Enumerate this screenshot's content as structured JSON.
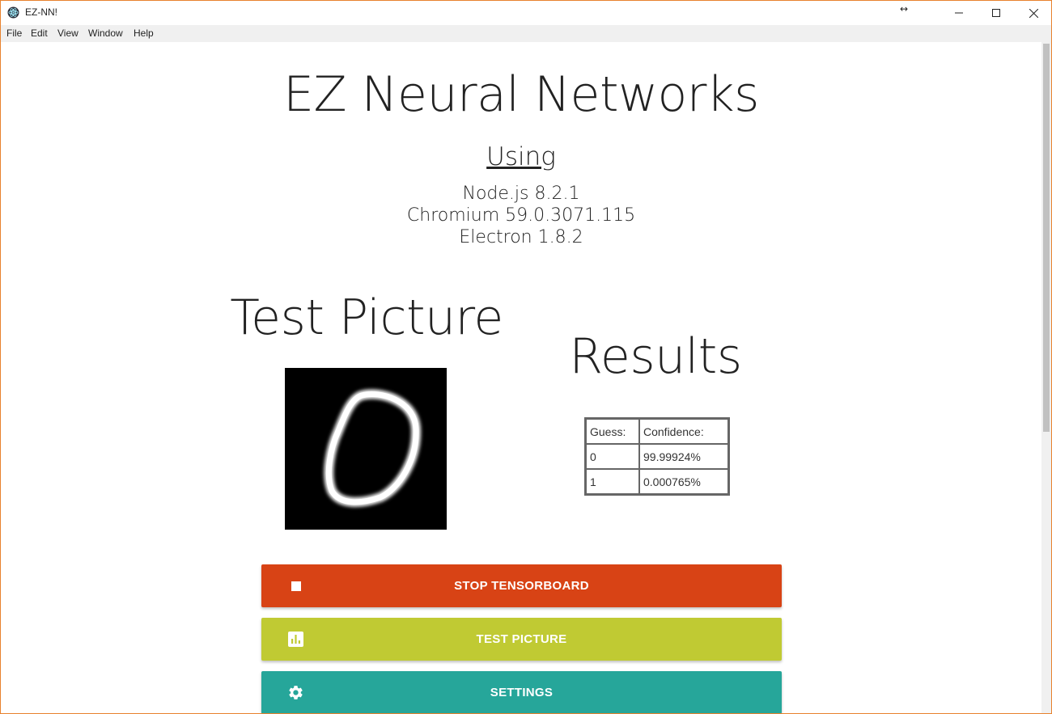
{
  "window": {
    "title": "EZ-NN!",
    "resize_glyph": "↔"
  },
  "menu": [
    "File",
    "Edit",
    "View",
    "Window",
    "Help"
  ],
  "header": {
    "title": "EZ Neural Networks",
    "using_label": "Using",
    "versions": [
      "Node.js 8.2.1",
      "Chromium 59.0.3071.115",
      "Electron 1.8.2"
    ]
  },
  "test_picture": {
    "title": "Test Picture"
  },
  "results": {
    "title": "Results",
    "headers": [
      "Guess:",
      "Confidence:"
    ],
    "rows": [
      [
        "0",
        "99.99924%"
      ],
      [
        "1",
        "0.000765%"
      ]
    ]
  },
  "buttons": {
    "stop_tensorboard": {
      "label": "STOP TENSORBOARD",
      "icon": "stop-icon",
      "color": "#d84315"
    },
    "test_picture": {
      "label": "TEST PICTURE",
      "icon": "chart-icon",
      "color": "#c0ca33"
    },
    "settings": {
      "label": "SETTINGS",
      "icon": "gear-icon",
      "color": "#26a69a"
    }
  }
}
